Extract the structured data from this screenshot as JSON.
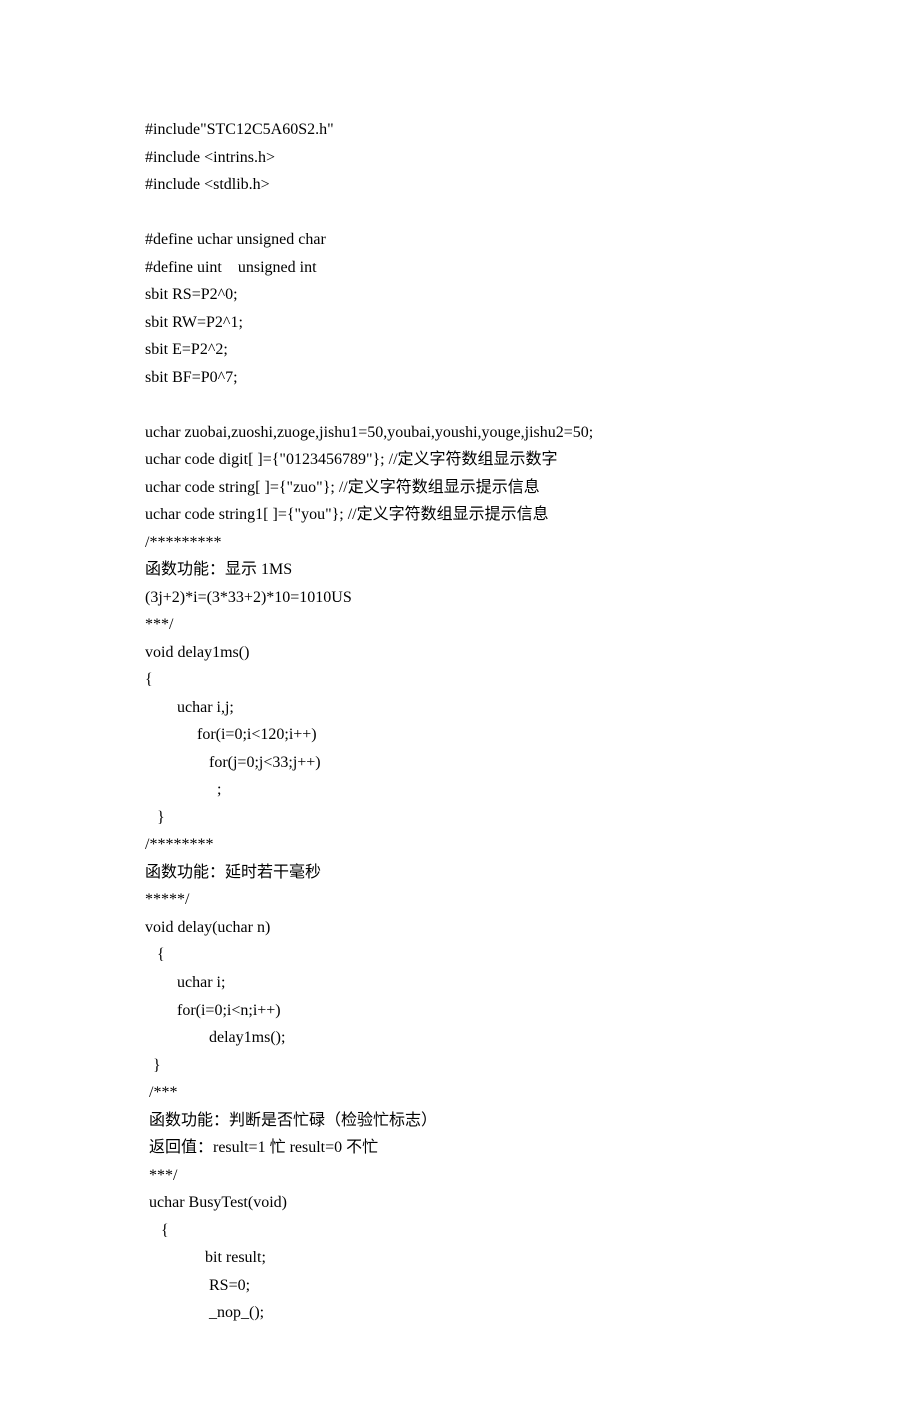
{
  "code": {
    "l1": "#include\"STC12C5A60S2.h\"",
    "l2": "#include <intrins.h>",
    "l3": "#include <stdlib.h>",
    "l4": "",
    "l5": "#define uchar unsigned char",
    "l6": "#define uint    unsigned int",
    "l7": "sbit RS=P2^0;",
    "l8": "sbit RW=P2^1;",
    "l9": "sbit E=P2^2;",
    "l10": "sbit BF=P0^7;",
    "l11": "",
    "l12": "uchar zuobai,zuoshi,zuoge,jishu1=50,youbai,youshi,youge,jishu2=50;",
    "l13": "uchar code digit[ ]={\"0123456789\"}; //定义字符数组显示数字",
    "l14": "uchar code string[ ]={\"zuo\"}; //定义字符数组显示提示信息",
    "l15": "uchar code string1[ ]={\"you\"}; //定义字符数组显示提示信息",
    "l16": "/*********",
    "l17": "函数功能：显示 1MS",
    "l18": "(3j+2)*i=(3*33+2)*10=1010US",
    "l19": "***/",
    "l20": "void delay1ms()",
    "l21": "{",
    "l22": "        uchar i,j;",
    "l23": "             for(i=0;i<120;i++)",
    "l24": "                for(j=0;j<33;j++)",
    "l25": "                  ;",
    "l26": "   }",
    "l27": "/********",
    "l28": "函数功能：延时若干毫秒",
    "l29": "*****/",
    "l30": "void delay(uchar n)",
    "l31": "   {",
    "l32": "        uchar i;",
    "l33": "        for(i=0;i<n;i++)",
    "l34": "                delay1ms();",
    "l35": "  }",
    "l36": " /***",
    "l37": " 函数功能：判断是否忙碌（检验忙标志）",
    "l38": " 返回值：result=1 忙 result=0 不忙",
    "l39": " ***/",
    "l40": " uchar BusyTest(void)",
    "l41": "    {",
    "l42": "               bit result;",
    "l43": "                RS=0;",
    "l44": "                _nop_();"
  }
}
